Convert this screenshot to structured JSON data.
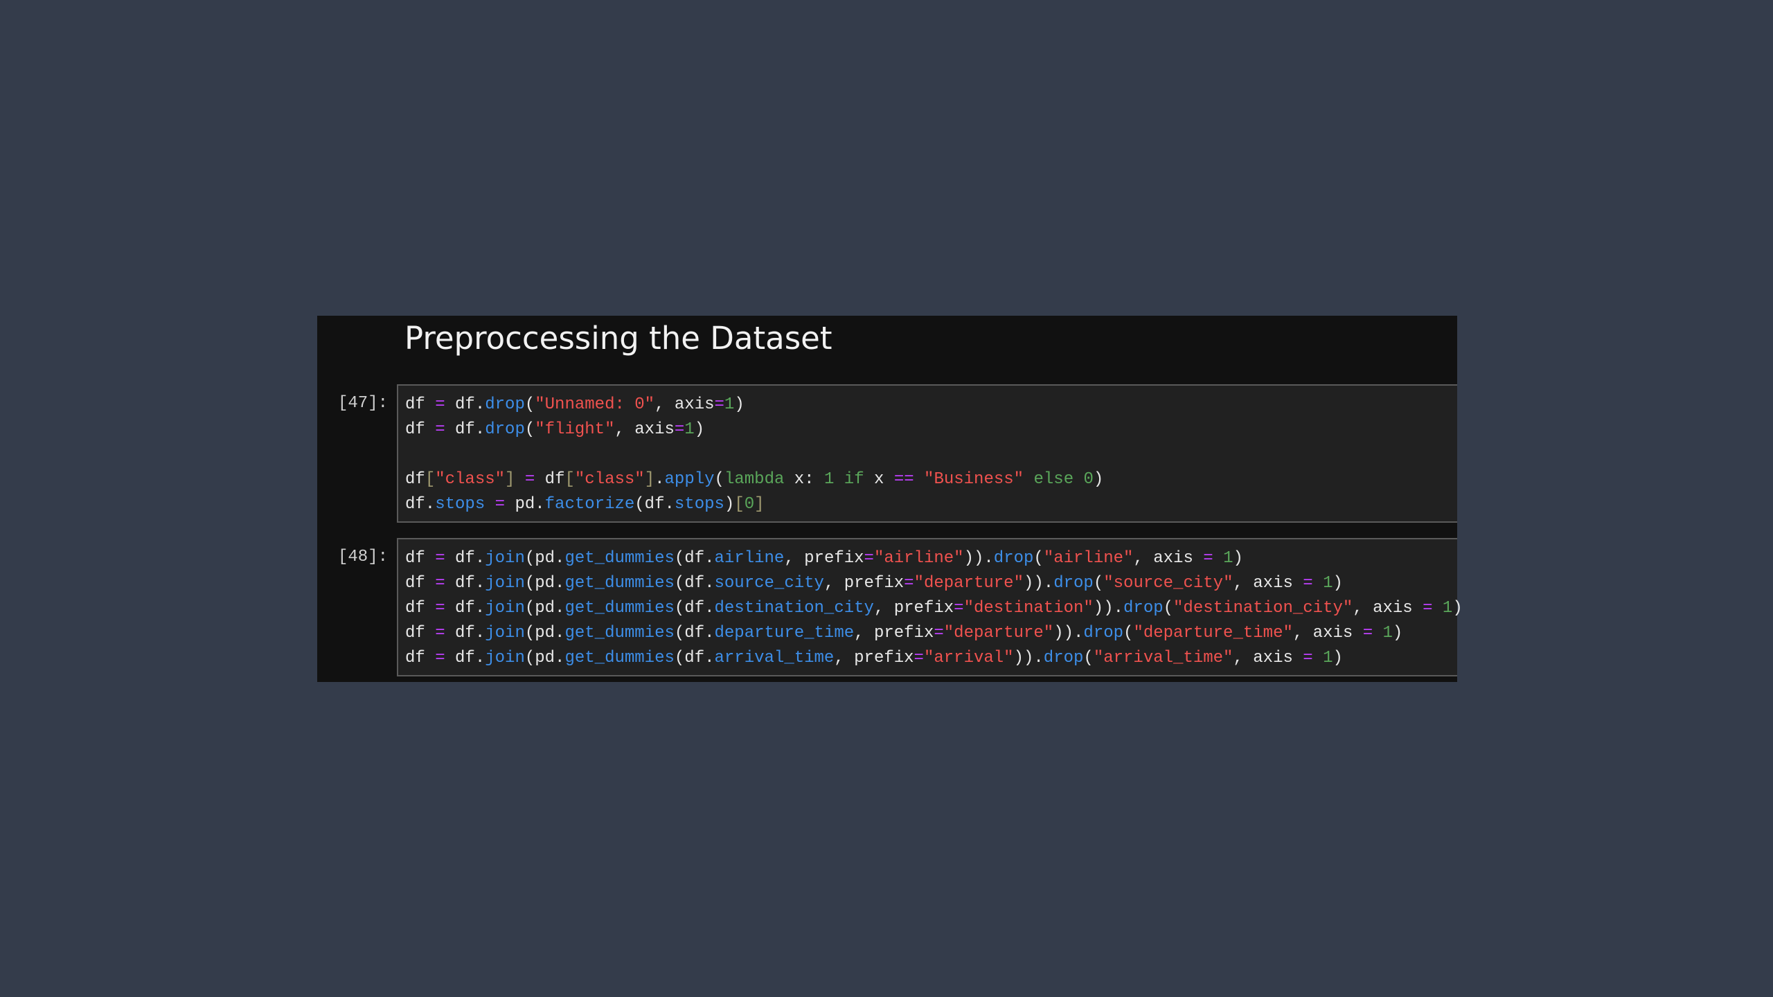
{
  "notebook": {
    "heading": "Preproccessing the Dataset",
    "colors": {
      "background": "#343c4b",
      "panel": "#111111",
      "cell": "#212121",
      "string": "#f0524f",
      "function": "#3d8ee8",
      "number": "#5aa65a",
      "operator": "#c040ff"
    },
    "cells": [
      {
        "prompt": "[47]:",
        "lines": [
          [
            [
              "t",
              "df "
            ],
            [
              "o",
              "="
            ],
            [
              "t",
              " df."
            ],
            [
              "f",
              "drop"
            ],
            [
              "t",
              "("
            ],
            [
              "s",
              "\"Unnamed: 0\""
            ],
            [
              "t",
              ", axis"
            ],
            [
              "o",
              "="
            ],
            [
              "n",
              "1"
            ],
            [
              "t",
              ")"
            ]
          ],
          [
            [
              "t",
              "df "
            ],
            [
              "o",
              "="
            ],
            [
              "t",
              " df."
            ],
            [
              "f",
              "drop"
            ],
            [
              "t",
              "("
            ],
            [
              "s",
              "\"flight\""
            ],
            [
              "t",
              ", axis"
            ],
            [
              "o",
              "="
            ],
            [
              "n",
              "1"
            ],
            [
              "t",
              ")"
            ]
          ],
          [],
          [
            [
              "t",
              "df"
            ],
            [
              "b",
              "["
            ],
            [
              "s",
              "\"class\""
            ],
            [
              "b",
              "]"
            ],
            [
              "t",
              " "
            ],
            [
              "o",
              "="
            ],
            [
              "t",
              " df"
            ],
            [
              "b",
              "["
            ],
            [
              "s",
              "\"class\""
            ],
            [
              "b",
              "]"
            ],
            [
              "t",
              "."
            ],
            [
              "f",
              "apply"
            ],
            [
              "t",
              "("
            ],
            [
              "k",
              "lambda"
            ],
            [
              "t",
              " x: "
            ],
            [
              "n",
              "1"
            ],
            [
              "t",
              " "
            ],
            [
              "k",
              "if"
            ],
            [
              "t",
              " x "
            ],
            [
              "o",
              "=="
            ],
            [
              "t",
              " "
            ],
            [
              "s",
              "\"Business\""
            ],
            [
              "t",
              " "
            ],
            [
              "k",
              "else"
            ],
            [
              "t",
              " "
            ],
            [
              "n",
              "0"
            ],
            [
              "t",
              ")"
            ]
          ],
          [
            [
              "t",
              "df."
            ],
            [
              "f",
              "stops"
            ],
            [
              "t",
              " "
            ],
            [
              "o",
              "="
            ],
            [
              "t",
              " pd."
            ],
            [
              "f",
              "factorize"
            ],
            [
              "t",
              "(df."
            ],
            [
              "f",
              "stops"
            ],
            [
              "t",
              ")"
            ],
            [
              "b",
              "["
            ],
            [
              "n",
              "0"
            ],
            [
              "b",
              "]"
            ]
          ]
        ]
      },
      {
        "prompt": "[48]:",
        "lines": [
          [
            [
              "t",
              "df "
            ],
            [
              "o",
              "="
            ],
            [
              "t",
              " df."
            ],
            [
              "f",
              "join"
            ],
            [
              "t",
              "(pd."
            ],
            [
              "f",
              "get_dummies"
            ],
            [
              "t",
              "(df."
            ],
            [
              "f",
              "airline"
            ],
            [
              "t",
              ", prefix"
            ],
            [
              "o",
              "="
            ],
            [
              "s",
              "\"airline\""
            ],
            [
              "t",
              "))."
            ],
            [
              "f",
              "drop"
            ],
            [
              "t",
              "("
            ],
            [
              "s",
              "\"airline\""
            ],
            [
              "t",
              ", axis "
            ],
            [
              "o",
              "="
            ],
            [
              "t",
              " "
            ],
            [
              "n",
              "1"
            ],
            [
              "t",
              ")"
            ]
          ],
          [
            [
              "t",
              "df "
            ],
            [
              "o",
              "="
            ],
            [
              "t",
              " df."
            ],
            [
              "f",
              "join"
            ],
            [
              "t",
              "(pd."
            ],
            [
              "f",
              "get_dummies"
            ],
            [
              "t",
              "(df."
            ],
            [
              "f",
              "source_city"
            ],
            [
              "t",
              ", prefix"
            ],
            [
              "o",
              "="
            ],
            [
              "s",
              "\"departure\""
            ],
            [
              "t",
              "))."
            ],
            [
              "f",
              "drop"
            ],
            [
              "t",
              "("
            ],
            [
              "s",
              "\"source_city\""
            ],
            [
              "t",
              ", axis "
            ],
            [
              "o",
              "="
            ],
            [
              "t",
              " "
            ],
            [
              "n",
              "1"
            ],
            [
              "t",
              ")"
            ]
          ],
          [
            [
              "t",
              "df "
            ],
            [
              "o",
              "="
            ],
            [
              "t",
              " df."
            ],
            [
              "f",
              "join"
            ],
            [
              "t",
              "(pd."
            ],
            [
              "f",
              "get_dummies"
            ],
            [
              "t",
              "(df."
            ],
            [
              "f",
              "destination_city"
            ],
            [
              "t",
              ", prefix"
            ],
            [
              "o",
              "="
            ],
            [
              "s",
              "\"destination\""
            ],
            [
              "t",
              "))."
            ],
            [
              "f",
              "drop"
            ],
            [
              "t",
              "("
            ],
            [
              "s",
              "\"destination_city\""
            ],
            [
              "t",
              ", axis "
            ],
            [
              "o",
              "="
            ],
            [
              "t",
              " "
            ],
            [
              "n",
              "1"
            ],
            [
              "t",
              ")"
            ]
          ],
          [
            [
              "t",
              "df "
            ],
            [
              "o",
              "="
            ],
            [
              "t",
              " df."
            ],
            [
              "f",
              "join"
            ],
            [
              "t",
              "(pd."
            ],
            [
              "f",
              "get_dummies"
            ],
            [
              "t",
              "(df."
            ],
            [
              "f",
              "departure_time"
            ],
            [
              "t",
              ", prefix"
            ],
            [
              "o",
              "="
            ],
            [
              "s",
              "\"departure\""
            ],
            [
              "t",
              "))."
            ],
            [
              "f",
              "drop"
            ],
            [
              "t",
              "("
            ],
            [
              "s",
              "\"departure_time\""
            ],
            [
              "t",
              ", axis "
            ],
            [
              "o",
              "="
            ],
            [
              "t",
              " "
            ],
            [
              "n",
              "1"
            ],
            [
              "t",
              ")"
            ]
          ],
          [
            [
              "t",
              "df "
            ],
            [
              "o",
              "="
            ],
            [
              "t",
              " df."
            ],
            [
              "f",
              "join"
            ],
            [
              "t",
              "(pd."
            ],
            [
              "f",
              "get_dummies"
            ],
            [
              "t",
              "(df."
            ],
            [
              "f",
              "arrival_time"
            ],
            [
              "t",
              ", prefix"
            ],
            [
              "o",
              "="
            ],
            [
              "s",
              "\"arrival\""
            ],
            [
              "t",
              "))."
            ],
            [
              "f",
              "drop"
            ],
            [
              "t",
              "("
            ],
            [
              "s",
              "\"arrival_time\""
            ],
            [
              "t",
              ", axis "
            ],
            [
              "o",
              "="
            ],
            [
              "t",
              " "
            ],
            [
              "n",
              "1"
            ],
            [
              "t",
              ")"
            ]
          ]
        ]
      }
    ]
  }
}
